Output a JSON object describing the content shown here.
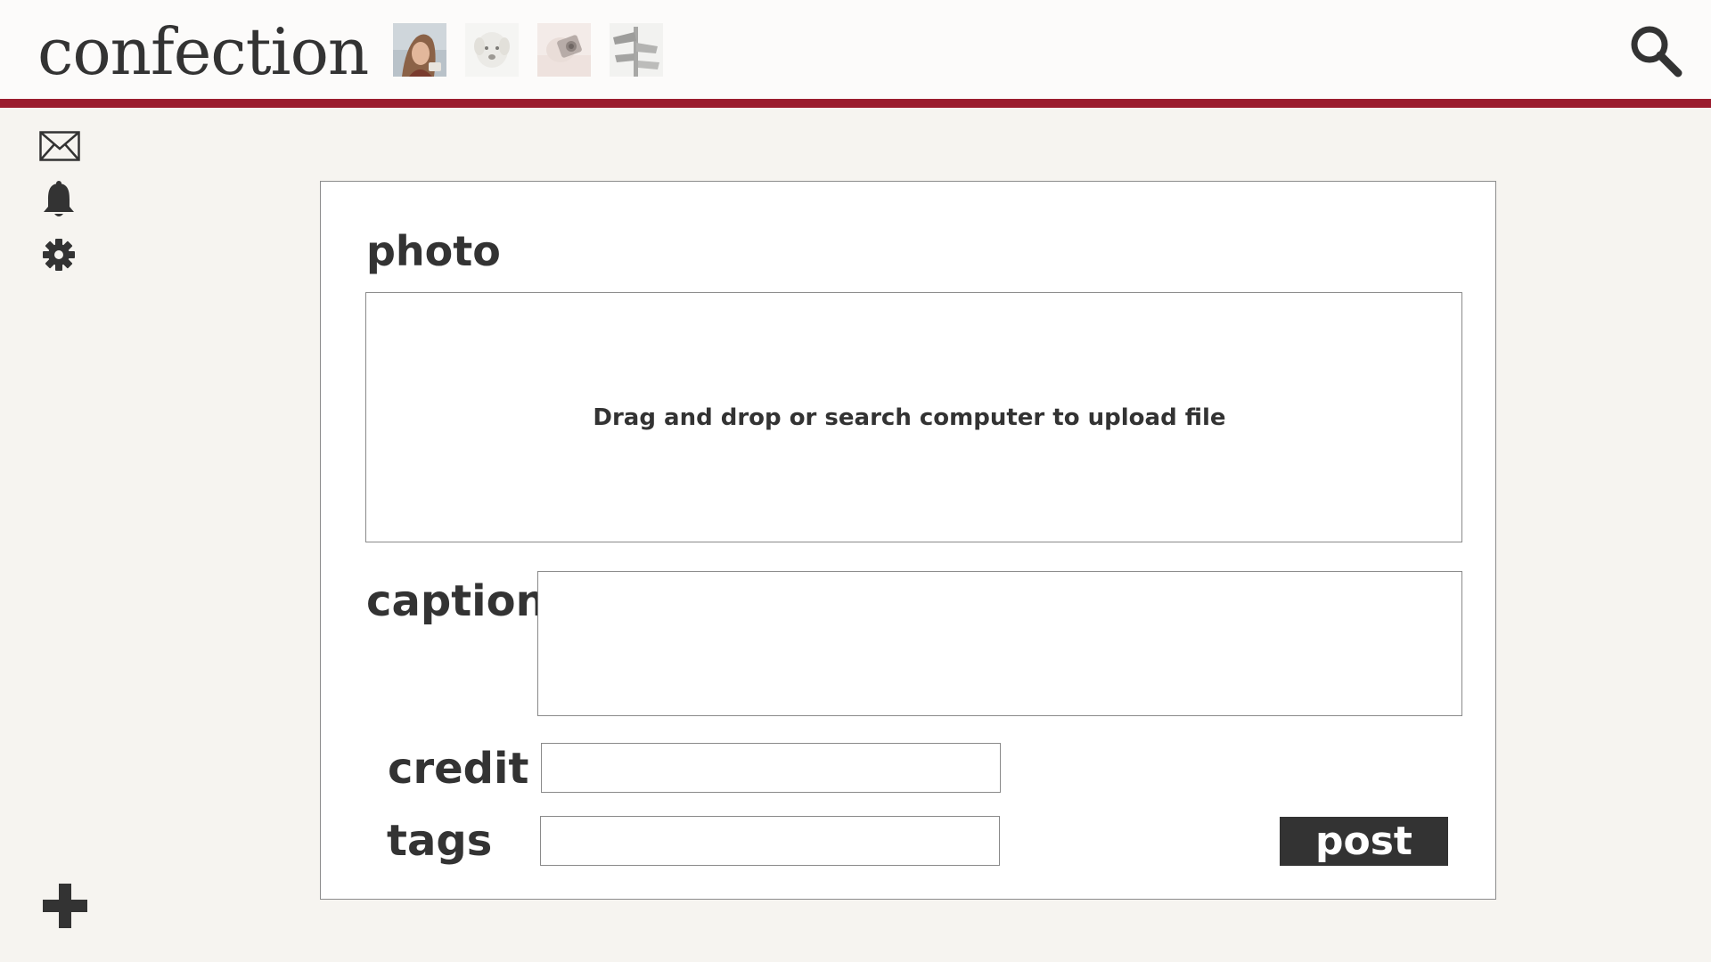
{
  "app": {
    "title": "confection"
  },
  "header": {
    "thumbnails": [
      {
        "icon": "portrait-photo-thumbnail"
      },
      {
        "icon": "dog-photo-thumbnail"
      },
      {
        "icon": "camera-photo-thumbnail"
      },
      {
        "icon": "signpost-photo-thumbnail"
      }
    ],
    "search_icon": "search-icon"
  },
  "sidebar": {
    "items": [
      {
        "icon": "mail-icon"
      },
      {
        "icon": "bell-icon"
      },
      {
        "icon": "gear-icon"
      }
    ],
    "add_icon": "plus-icon"
  },
  "form": {
    "photo_label": "photo",
    "dropzone_text": "Drag and drop or search computer to upload file",
    "caption_label": "caption",
    "caption_value": "",
    "credit_label": "credit",
    "credit_value": "",
    "tags_label": "tags",
    "tags_value": "",
    "post_label": "post"
  },
  "colors": {
    "accent": "#9b1c2e",
    "text": "#333333",
    "background": "#f6f4f0",
    "card": "#ffffff",
    "button": "#333333"
  }
}
